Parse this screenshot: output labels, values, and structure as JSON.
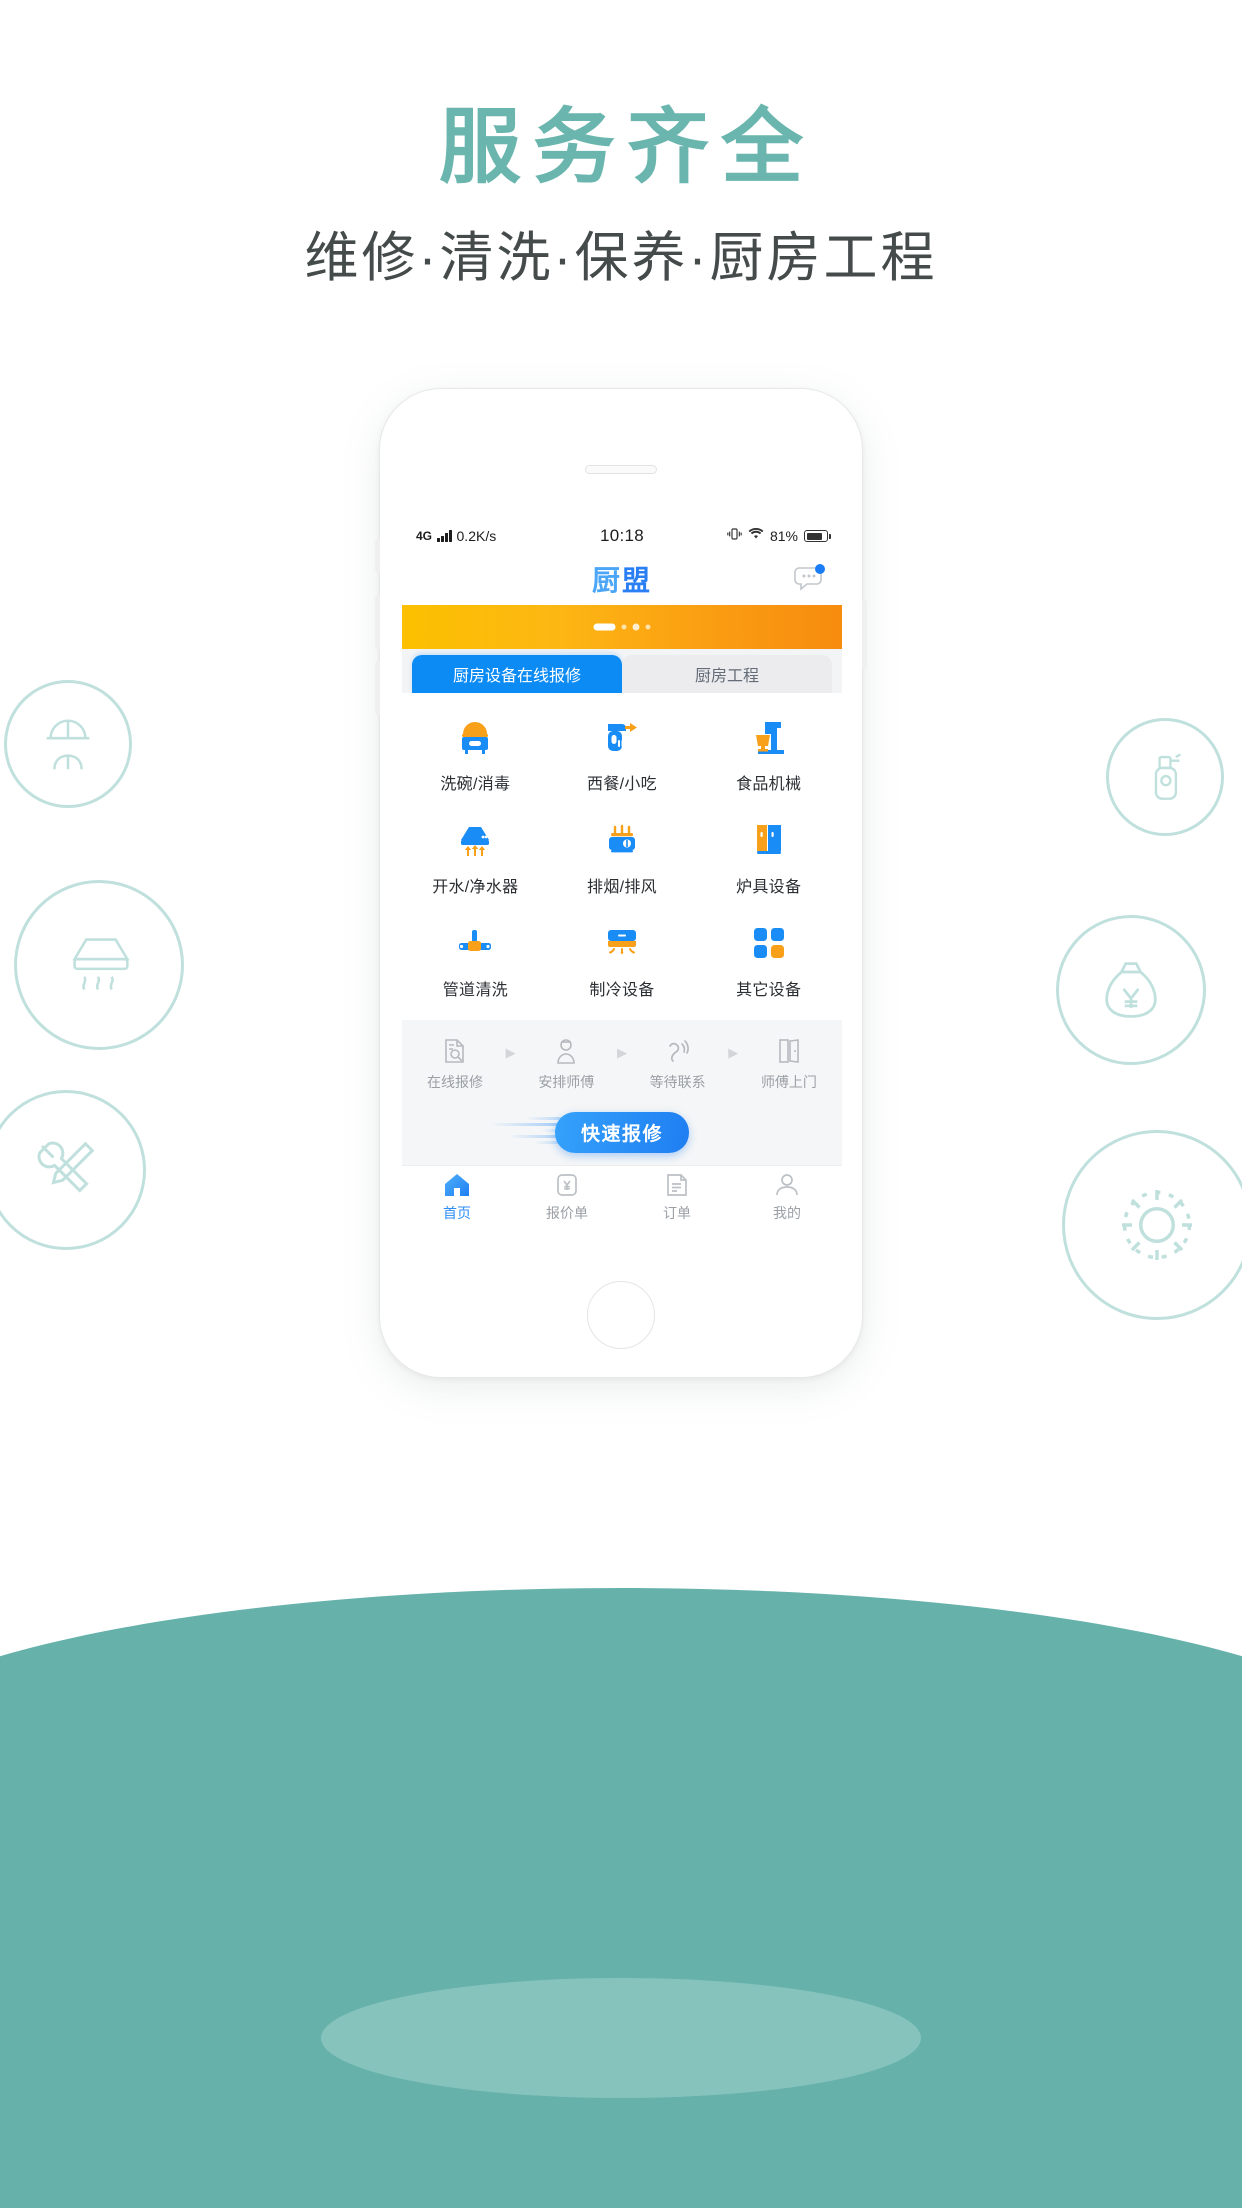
{
  "hero": {
    "title": "服务齐全",
    "subtitle": "维修·清洗·保养·厨房工程",
    "title_color": "#6ab6ae",
    "band_color": "#66b2ab"
  },
  "decorations": [
    {
      "name": "worker-helmet-icon"
    },
    {
      "name": "spray-bottle-icon"
    },
    {
      "name": "range-hood-icon"
    },
    {
      "name": "money-bag-yuan-icon"
    },
    {
      "name": "wrench-screwdriver-icon"
    },
    {
      "name": "gear-icon"
    }
  ],
  "phone": {
    "statusbar": {
      "network": "4G",
      "speed": "0.2K/s",
      "time": "10:18",
      "battery_percent": "81%",
      "icons": [
        "signal-bars-icon",
        "vibrate-icon",
        "wifi-icon",
        "battery-icon"
      ]
    },
    "header": {
      "logo_part1": "厨",
      "logo_part2": "盟",
      "logo_color": "#2e8ef7",
      "chat_icon": "chat-bubble-icon",
      "badge_color": "#1a7df5"
    },
    "banner": {
      "gradient_from": "#fcc000",
      "gradient_to": "#f78c0e"
    },
    "tabs": [
      {
        "label": "厨房设备在线报修",
        "active": true
      },
      {
        "label": "厨房工程",
        "active": false
      }
    ],
    "services": [
      {
        "label": "洗碗/消毒",
        "icon": "dishwasher-sterilizer-icon"
      },
      {
        "label": "西餐/小吃",
        "icon": "hand-mixer-icon"
      },
      {
        "label": "食品机械",
        "icon": "stand-mixer-icon"
      },
      {
        "label": "开水/净水器",
        "icon": "water-boiler-purifier-icon"
      },
      {
        "label": "排烟/排风",
        "icon": "exhaust-fan-icon"
      },
      {
        "label": "炉具设备",
        "icon": "stove-cabinet-icon"
      },
      {
        "label": "管道清洗",
        "icon": "pipe-cleaning-icon"
      },
      {
        "label": "制冷设备",
        "icon": "air-conditioner-icon"
      },
      {
        "label": "其它设备",
        "icon": "grid-four-squares-icon"
      }
    ],
    "steps": [
      {
        "label": "在线报修",
        "icon": "document-search-icon"
      },
      {
        "label": "安排师傅",
        "icon": "technician-person-icon"
      },
      {
        "label": "等待联系",
        "icon": "phone-ringing-icon"
      },
      {
        "label": "师傅上门",
        "icon": "door-open-icon"
      }
    ],
    "step_arrow": "▶",
    "cta": {
      "label": "快速报修"
    },
    "bottom_nav": [
      {
        "label": "首页",
        "icon": "home-icon",
        "active": true
      },
      {
        "label": "报价单",
        "icon": "quote-yuan-icon",
        "active": false
      },
      {
        "label": "订单",
        "icon": "order-list-icon",
        "active": false
      },
      {
        "label": "我的",
        "icon": "user-profile-icon",
        "active": false
      }
    ]
  },
  "accents": {
    "blue": "#2e8ef7",
    "blue_dark": "#1f7ef2",
    "orange": "#f9a01b",
    "teal": "#66b2ab"
  }
}
